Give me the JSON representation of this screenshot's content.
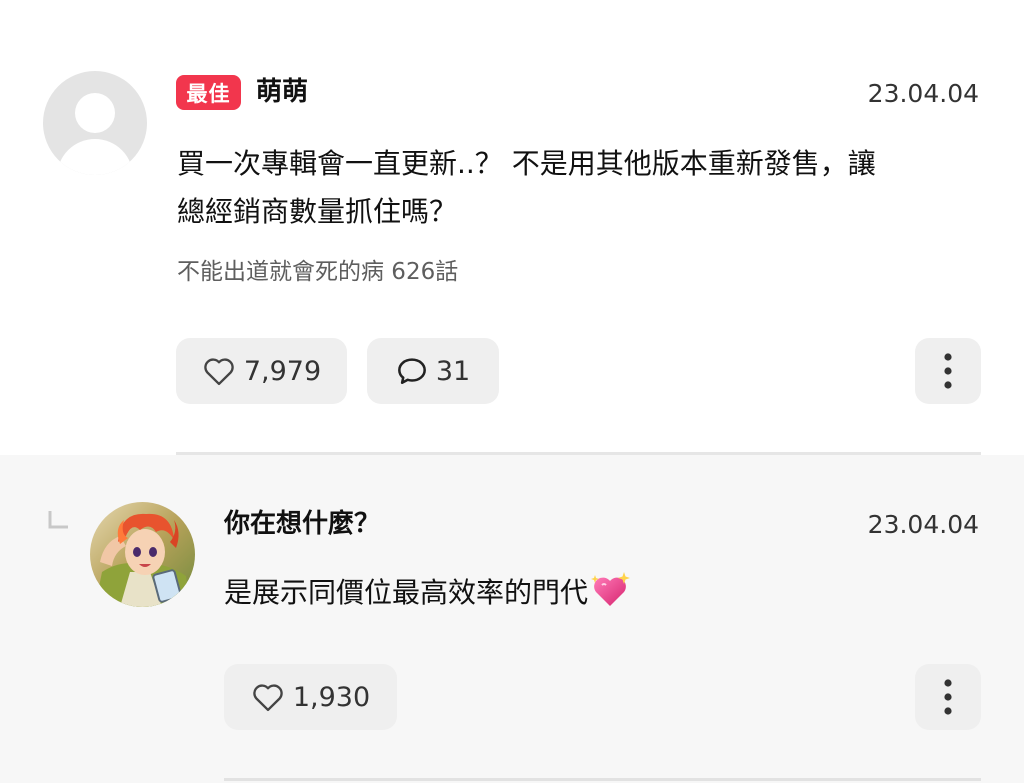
{
  "comment": {
    "badge": "最佳",
    "author": "萌萌",
    "date": "23.04.04",
    "text_line1": "買一次專輯會一直更新..？ 不是用其他版本重新發售，讓",
    "text_line2": "總經銷商數量抓住嗎？",
    "episode": "不能出道就會死的病 626話",
    "likes": "7,979",
    "replies": "31",
    "icons": {
      "like": "heart-outline-icon",
      "reply": "speech-bubble-icon",
      "more": "more-vertical-icon"
    }
  },
  "reply": {
    "author": "你在想什麼？",
    "date": "23.04.04",
    "text": "是展示同價位最高效率的門代",
    "emoji": "sparkling-heart-icon",
    "likes": "1,930"
  },
  "colors": {
    "badge": "#f2364d",
    "pill_bg": "#efefef",
    "reply_bg": "#f7f7f7",
    "date": "#333333",
    "episode": "#5e5e5e"
  }
}
